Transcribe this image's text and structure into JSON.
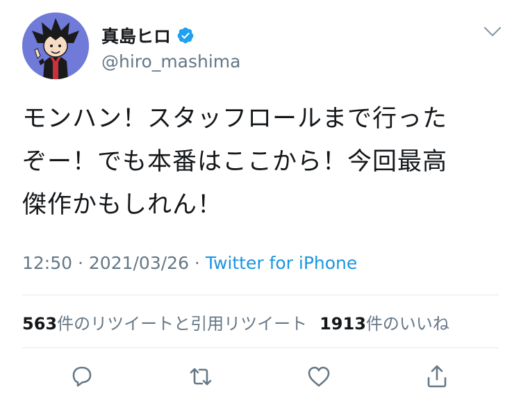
{
  "user": {
    "display_name": "真島ヒロ",
    "handle": "@hiro_mashima",
    "avatar_icon": "manga-character-avatar",
    "verified_icon": "verified-badge-icon"
  },
  "tweet": {
    "lines": [
      "モンハン！スタッフロールまで行った",
      "ぞー！でも本番はここから！今回最高",
      "傑作かもしれん！"
    ]
  },
  "meta": {
    "time": "12:50",
    "sep1": " · ",
    "date": "2021/03/26",
    "sep2": " · ",
    "source": "Twitter for iPhone"
  },
  "stats": {
    "retweets_count": "563",
    "retweets_label": "件のリツイートと引用リツイート",
    "likes_count": "1913",
    "likes_label": "件のいいね"
  },
  "actions": {
    "reply_icon": "reply-icon",
    "retweet_icon": "retweet-icon",
    "like_icon": "heart-icon",
    "share_icon": "share-icon"
  },
  "colors": {
    "text": "#14171a",
    "secondary": "#657786",
    "link": "#1b95e0",
    "divider": "#e1e8ed",
    "avatar_bg": "#6f7ad9"
  }
}
